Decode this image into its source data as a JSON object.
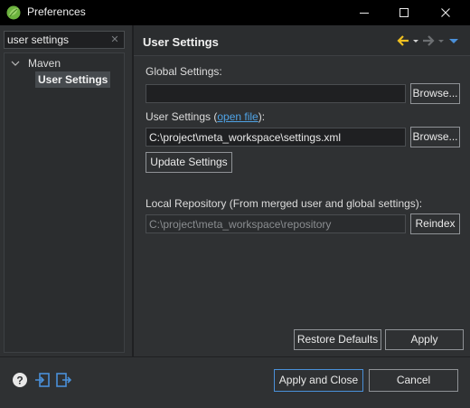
{
  "window": {
    "title": "Preferences",
    "minimize_icon": "minimize-icon",
    "maximize_icon": "maximize-icon",
    "close_icon": "close-icon"
  },
  "filter": {
    "value": "user settings"
  },
  "tree": {
    "parent_label": "Maven",
    "child_label": "User Settings"
  },
  "page": {
    "title": "User Settings"
  },
  "global_settings": {
    "label": "Global Settings:",
    "value": "",
    "browse_label": "Browse..."
  },
  "user_settings": {
    "label_prefix": "User Settings (",
    "link_text": "open file",
    "label_suffix": "):",
    "value": "C:\\project\\meta_workspace\\settings.xml",
    "browse_label": "Browse...",
    "update_label": "Update Settings"
  },
  "local_repo": {
    "label": "Local Repository (From merged user and global settings):",
    "value": "C:\\project\\meta_workspace\\repository",
    "reindex_label": "Reindex"
  },
  "actions": {
    "restore_defaults": "Restore Defaults",
    "apply": "Apply",
    "apply_and_close": "Apply and Close",
    "cancel": "Cancel"
  },
  "colors": {
    "accent": "#4a90d9",
    "back_arrow": "#f0c020",
    "link": "#4fa3e6"
  }
}
